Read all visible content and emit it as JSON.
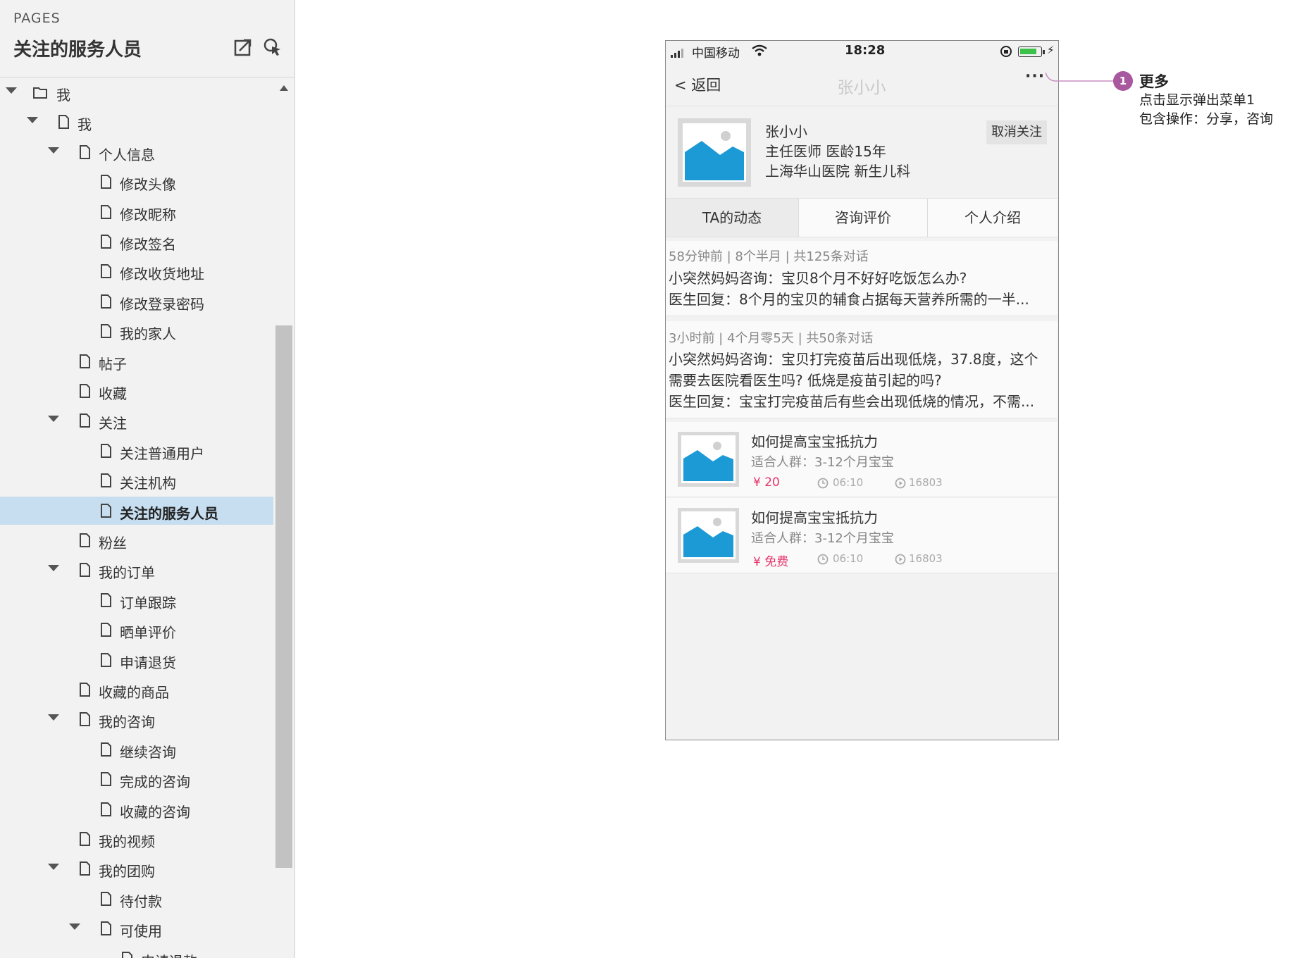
{
  "sidebar": {
    "section_label": "PAGES",
    "title": "关注的服务人员",
    "tree": [
      {
        "label": "我",
        "level": 0,
        "expanded": true,
        "type": "folder"
      },
      {
        "label": "我",
        "level": 1,
        "expanded": true,
        "type": "page"
      },
      {
        "label": "个人信息",
        "level": 2,
        "expanded": true,
        "type": "page"
      },
      {
        "label": "修改头像",
        "level": 3,
        "type": "page"
      },
      {
        "label": "修改昵称",
        "level": 3,
        "type": "page"
      },
      {
        "label": "修改签名",
        "level": 3,
        "type": "page"
      },
      {
        "label": "修改收货地址",
        "level": 3,
        "type": "page"
      },
      {
        "label": "修改登录密码",
        "level": 3,
        "type": "page"
      },
      {
        "label": "我的家人",
        "level": 3,
        "type": "page"
      },
      {
        "label": "帖子",
        "level": 2,
        "type": "page"
      },
      {
        "label": "收藏",
        "level": 2,
        "type": "page"
      },
      {
        "label": "关注",
        "level": 2,
        "expanded": true,
        "type": "page"
      },
      {
        "label": "关注普通用户",
        "level": 3,
        "type": "page"
      },
      {
        "label": "关注机构",
        "level": 3,
        "type": "page"
      },
      {
        "label": "关注的服务人员",
        "level": 3,
        "type": "page",
        "selected": true
      },
      {
        "label": "粉丝",
        "level": 2,
        "type": "page"
      },
      {
        "label": "我的订单",
        "level": 2,
        "expanded": true,
        "type": "page"
      },
      {
        "label": "订单跟踪",
        "level": 3,
        "type": "page"
      },
      {
        "label": "晒单评价",
        "level": 3,
        "type": "page"
      },
      {
        "label": "申请退货",
        "level": 3,
        "type": "page"
      },
      {
        "label": "收藏的商品",
        "level": 2,
        "type": "page"
      },
      {
        "label": "我的咨询",
        "level": 2,
        "expanded": true,
        "type": "page"
      },
      {
        "label": "继续咨询",
        "level": 3,
        "type": "page"
      },
      {
        "label": "完成的咨询",
        "level": 3,
        "type": "page"
      },
      {
        "label": "收藏的咨询",
        "level": 3,
        "type": "page"
      },
      {
        "label": "我的视频",
        "level": 2,
        "type": "page"
      },
      {
        "label": "我的团购",
        "level": 2,
        "expanded": true,
        "type": "page"
      },
      {
        "label": "待付款",
        "level": 3,
        "type": "page"
      },
      {
        "label": "可使用",
        "level": 3,
        "expanded": true,
        "type": "page"
      },
      {
        "label": "申请退款",
        "level": 4,
        "type": "page"
      }
    ]
  },
  "phone": {
    "status": {
      "carrier": "中国移动",
      "time": "18:28",
      "battery_level": 0.85,
      "bolt": "⚡"
    },
    "nav": {
      "back": "< 返回",
      "title": "张小小",
      "more": "···"
    },
    "profile": {
      "name": "张小小",
      "title": "主任医师  医龄15年",
      "hospital": "上海华山医院  新生儿科",
      "unfollow": "取消关注"
    },
    "tabs": [
      "TA的动态",
      "咨询评价",
      "个人介绍"
    ],
    "active_tab": 0,
    "consults": [
      {
        "meta": "58分钟前 |  8个半月 |  共125条对话",
        "lines": [
          "小突然妈妈咨询：宝贝8个月不好好吃饭怎么办?",
          "医生回复：8个月的宝贝的辅食占据每天营养所需的一半..."
        ]
      },
      {
        "meta": "3小时前 | 4个月零5天 |  共50条对话",
        "lines": [
          "小突然妈妈咨询：宝贝打完疫苗后出现低烧，37.8度，这个",
          "需要去医院看医生吗? 低烧是疫苗引起的吗?",
          "医生回复：宝宝打完疫苗后有些会出现低烧的情况，不需..."
        ]
      }
    ],
    "videos": [
      {
        "title": "如何提高宝宝抵抗力",
        "audience": "适合人群：3-12个月宝宝",
        "price": "¥ 20",
        "duration": "06:10",
        "views": "16803"
      },
      {
        "title": "如何提高宝宝抵抗力",
        "audience": "适合人群：3-12个月宝宝",
        "price": "¥ 免费",
        "duration": "06:10",
        "views": "16803"
      }
    ]
  },
  "annotation": {
    "badge": "1",
    "title": "更多",
    "line1": "点击显示弹出菜单1",
    "line2": "包含操作：分享，咨询"
  },
  "colors": {
    "accent_pink": "#e6336b",
    "badge_purple": "#a8589e",
    "selected_row": "#c7def0",
    "image_blue": "#1b9ad6"
  }
}
